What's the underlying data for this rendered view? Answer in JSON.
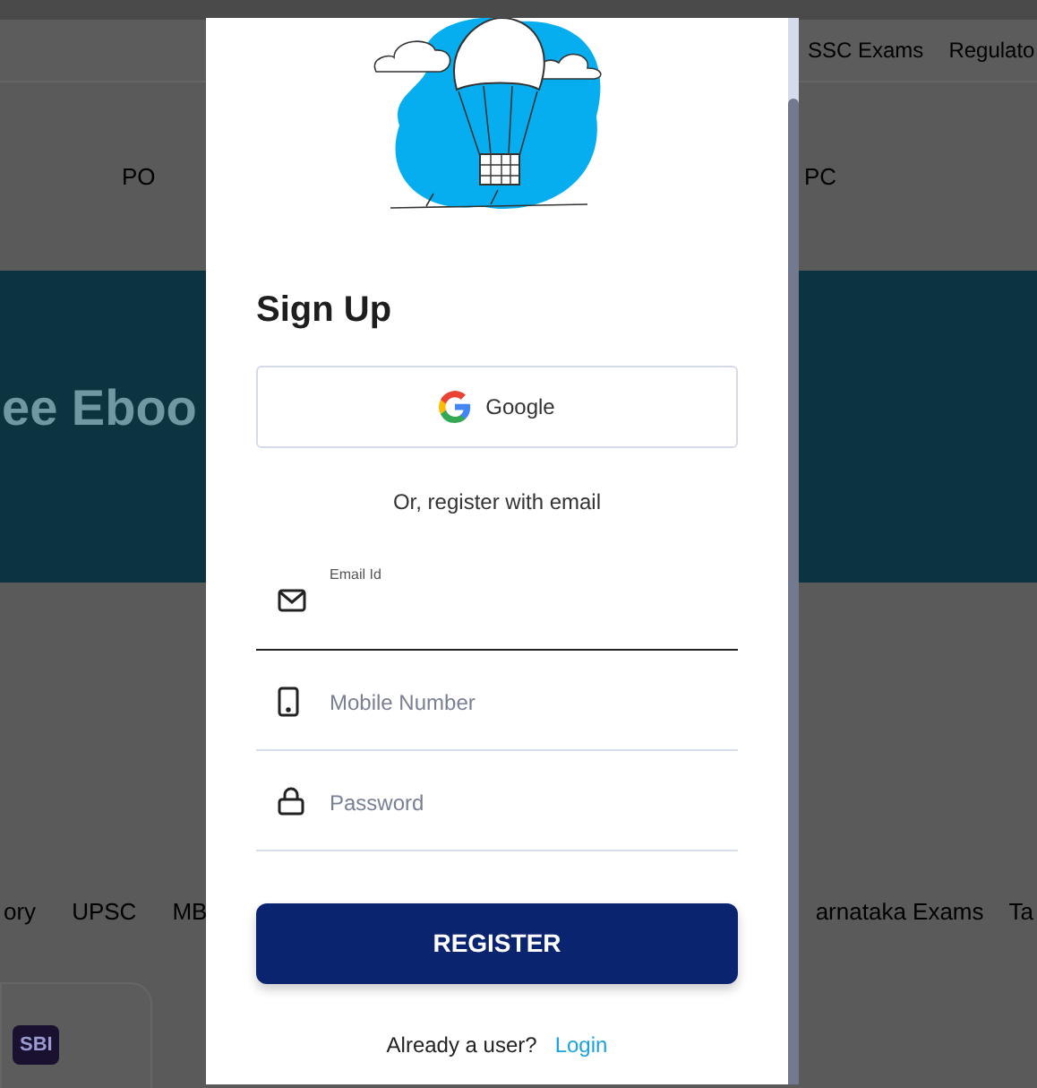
{
  "background": {
    "nav_links": [
      "SSC Exams",
      "Regulato"
    ],
    "sub_links_left": [
      "PO"
    ],
    "sub_links_right": [
      "PC"
    ],
    "banner_title": "ee Eboo",
    "category_tabs_left": [
      "ory",
      "UPSC",
      "MB"
    ],
    "category_tabs_right": [
      "arnataka Exams",
      "Ta"
    ],
    "card_logo": "SBI"
  },
  "modal": {
    "title": "Sign Up",
    "google_button": "Google",
    "divider_text": "Or, register with email",
    "fields": [
      {
        "kind": "email",
        "label": "Email Id",
        "focused": true
      },
      {
        "kind": "phone",
        "placeholder": "Mobile Number",
        "focused": false
      },
      {
        "kind": "password",
        "placeholder": "Password",
        "focused": false
      }
    ],
    "register_button": "REGISTER",
    "login_prompt": "Already a user?",
    "login_link": "Login"
  }
}
